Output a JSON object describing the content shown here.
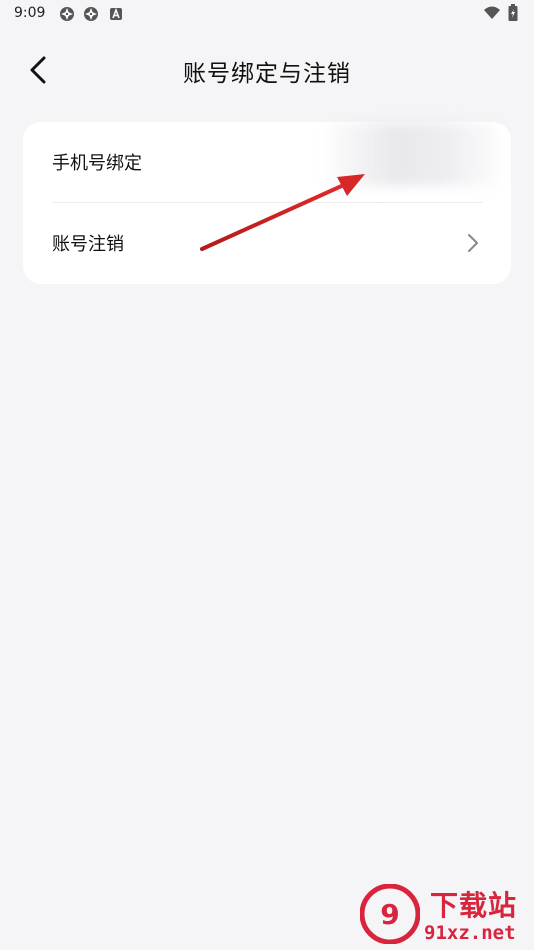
{
  "status_bar": {
    "time": "9:09",
    "left_icons": [
      "aperture-icon",
      "aperture-icon",
      "a-notification-icon"
    ],
    "right_icons": [
      "wifi-icon",
      "battery-icon"
    ]
  },
  "header": {
    "title": "账号绑定与注销",
    "back_icon": "chevron-left-icon"
  },
  "settings_card": {
    "items": [
      {
        "label": "手机号绑定",
        "value_blurred": true
      },
      {
        "label": "账号注销",
        "trailing_icon": "chevron-right-icon"
      }
    ]
  },
  "annotation": {
    "arrow_color": "#d62828"
  },
  "watermark": {
    "title": "下载站",
    "domain": "91xz.net",
    "color": "#d8243c"
  }
}
